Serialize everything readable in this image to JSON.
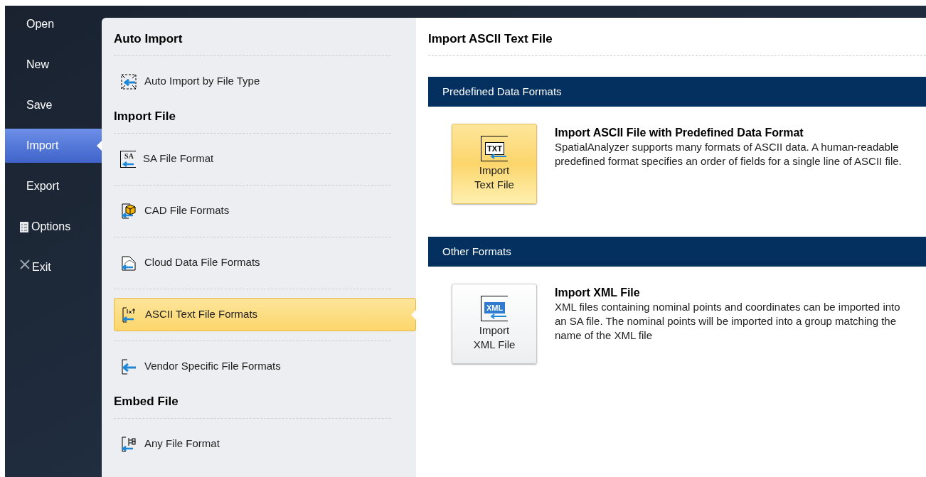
{
  "sidebar": {
    "items": [
      {
        "label": "Open",
        "kind": "plain",
        "selected": false
      },
      {
        "label": "New",
        "kind": "plain",
        "selected": false
      },
      {
        "label": "Save",
        "kind": "plain",
        "selected": false
      },
      {
        "label": "Import",
        "kind": "plain",
        "selected": true
      },
      {
        "label": "Export",
        "kind": "plain",
        "selected": false
      },
      {
        "label": "Options",
        "kind": "options",
        "selected": false
      },
      {
        "label": "Exit",
        "kind": "exit",
        "selected": false
      }
    ]
  },
  "categories": [
    {
      "heading": "Auto Import",
      "items": [
        {
          "label": "Auto Import by File Type",
          "kind": "auto",
          "selected": false
        }
      ]
    },
    {
      "heading": "Import File",
      "items": [
        {
          "label": "SA File Format",
          "kind": "sa",
          "icon_label": "SA",
          "selected": false
        },
        {
          "label": "CAD File Formats",
          "kind": "cad",
          "selected": false
        },
        {
          "label": "Cloud Data File Formats",
          "kind": "cloud",
          "selected": false
        },
        {
          "label": "ASCII Text File Formats",
          "kind": "ascii",
          "selected": true
        },
        {
          "label": "Vendor Specific File Formats",
          "kind": "vendor",
          "selected": false
        }
      ]
    },
    {
      "heading": "Embed File",
      "items": [
        {
          "label": "Any File Format",
          "kind": "any",
          "selected": false
        }
      ]
    }
  ],
  "detail": {
    "title": "Import ASCII Text File",
    "sections": [
      {
        "header": "Predefined Data Formats",
        "entries": [
          {
            "button_lines": [
              "Import",
              "Text File"
            ],
            "icon_label": "TXT",
            "kind": "txt",
            "highlighted": true,
            "title": "Import ASCII File with Predefined Data Format",
            "description": "SpatialAnalyzer supports many formats of ASCII data. A human-readable predefined format specifies an order of fields for a single line of ASCII file."
          }
        ]
      },
      {
        "header": "Other Formats",
        "entries": [
          {
            "button_lines": [
              "Import",
              "XML File"
            ],
            "icon_label": "XML",
            "kind": "xml",
            "highlighted": false,
            "title": "Import XML File",
            "description": "XML files containing nominal points and coordinates can be imported into an SA file. The nominal points will be imported into a group matching the name of the XML file"
          }
        ]
      }
    ]
  }
}
